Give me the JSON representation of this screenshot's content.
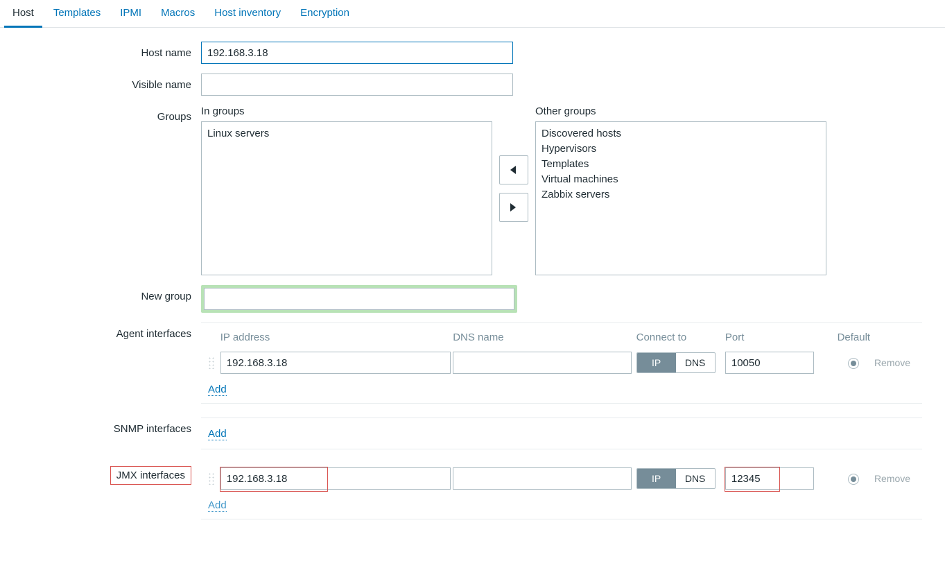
{
  "tabs": [
    "Host",
    "Templates",
    "IPMI",
    "Macros",
    "Host inventory",
    "Encryption"
  ],
  "activeTab": 0,
  "labels": {
    "hostname": "Host name",
    "visiblename": "Visible name",
    "groups": "Groups",
    "ingroups": "In groups",
    "othergroups": "Other groups",
    "newgroup": "New group",
    "agent": "Agent interfaces",
    "snmp": "SNMP interfaces",
    "jmx": "JMX interfaces",
    "ip": "IP address",
    "dns": "DNS name",
    "connect": "Connect to",
    "port": "Port",
    "default": "Default",
    "remove": "Remove",
    "add": "Add",
    "ipbtn": "IP",
    "dnsbtn": "DNS"
  },
  "values": {
    "hostname": "192.168.3.18",
    "visiblename": "",
    "newgroup": "",
    "ingroups": [
      "Linux servers"
    ],
    "othergroups": [
      "Discovered hosts",
      "Hypervisors",
      "Templates",
      "Virtual machines",
      "Zabbix servers"
    ],
    "agent": {
      "ip": "192.168.3.18",
      "dns": "",
      "port": "10050"
    },
    "jmx": {
      "ip": "192.168.3.18",
      "dns": "",
      "port": "12345"
    }
  }
}
